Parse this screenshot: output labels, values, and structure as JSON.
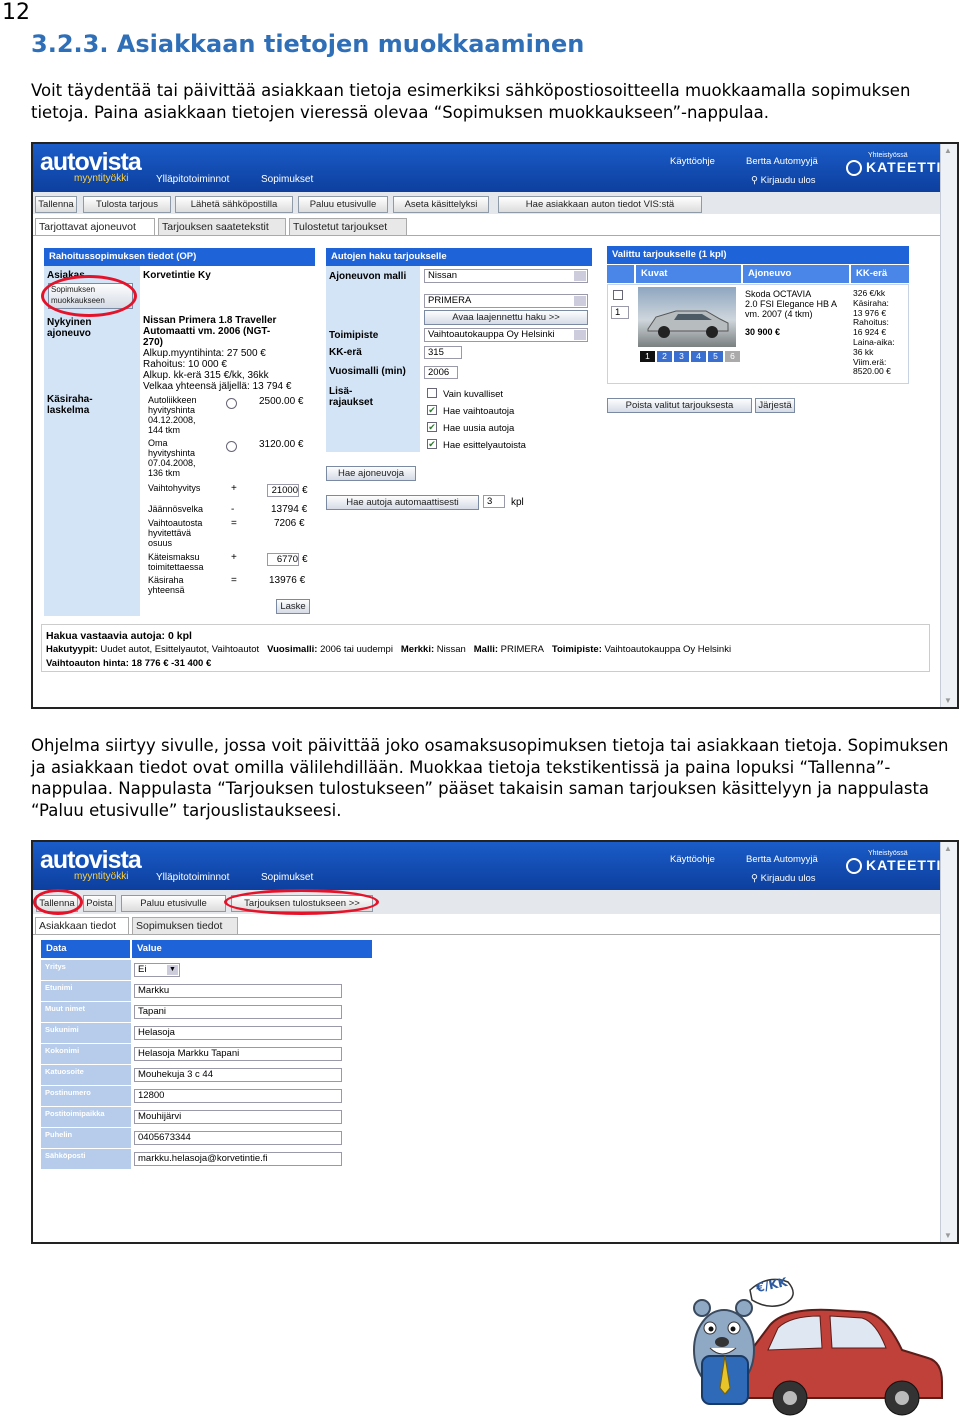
{
  "page": {
    "number": "12",
    "heading": "3.2.3. Asiakkaan tietojen muokkaaminen",
    "intro": "Voit täydentää tai päivittää asiakkaan tietoja esimerkiksi sähköpostiosoitteella muokkaamalla sopimuksen tietoja. Paina asiakkaan tietojen vieressä olevaa “Sopimuksen muokkaukseen”-nappulaa.",
    "middle": "Ohjelma siirtyy sivulle, jossa voit päivittää joko osamaksusopimuksen tietoja tai asiakkaan tietoja. Sopimuksen ja asiakkaan tiedot ovat omilla välilehdillään. Muokkaa tietoja tekstikentissä ja paina lopuksi “Tallenna”-nappulaa. Nappulasta “Tarjouksen tulostukseen” pääset takaisin saman tarjouksen käsittelyyn ja nappulasta “Paluu etusivulle” tarjouslistaukseesi."
  },
  "app": {
    "logo": "autovista",
    "logo_sub": "myyntityökki",
    "nav_admin": "Ylläpitotoiminnot",
    "nav_contracts": "Sopimukset",
    "help": "Käyttöohje",
    "user": "Bertta Automyyjä",
    "logout": "Kirjaudu ulos",
    "partner_small": "Yhteistyössä",
    "partner": "KATEETTI"
  },
  "s1": {
    "toolbar": [
      "Tallenna",
      "Tulosta tarjous",
      "Lähetä sähköpostilla",
      "Paluu etusivulle",
      "Aseta käsittelyksi",
      "Hae asiakkaan auton tiedot VIS:stä"
    ],
    "tabs": [
      "Tarjottavat ajoneuvot",
      "Tarjouksen saatetekstit",
      "Tulostetut tarjoukset"
    ],
    "col1_header": "Rahoitussopimuksen tiedot (OP)",
    "asiakas_label": "Asiakas",
    "asiakas_value": "Korvetintie Ky",
    "edit_btn": "Sopimuksen muokkaukseen",
    "current_label": "Nykyinen ajoneuvo",
    "current_lines": [
      "Nissan Primera 1.8 Traveller",
      "Automaatti vm. 2006 (NGT-",
      "270)"
    ],
    "current_details": [
      "Alkup.myyntihinta: 27 500 €",
      "Rahoitus: 10 000 €",
      "Alkup. kk-erä 315 €/kk, 36kk",
      "Velkaa yhteensä jäljellä: 13 794 €"
    ],
    "calc_label": "Käsiraha-laskelma",
    "calc": [
      {
        "l1": "Autoliikkeen",
        "l2": "hyvityshinta",
        "l3": "04.12.2008,",
        "l4": "144 tkm",
        "v": "2500.00 €"
      },
      {
        "l1": "Oma",
        "l2": "hyvityshinta",
        "l3": "07.04.2008,",
        "l4": "136 tkm",
        "v": "3120.00 €"
      }
    ],
    "vaihtohyvitys": "Vaihtohyvitys",
    "vaihtohyvitys_v": "21000",
    "jaannos": "Jäännösvelka",
    "jaannos_v": "13794 €",
    "vaihtoauto1": "Vaihtoautosta",
    "vaihtoauto2": "hyvitettävä",
    "vaihtoauto3": "osuus",
    "vaihtoauto_v": "7206 €",
    "kate1": "Käteismaksu",
    "kate2": "toimitettaessa",
    "kate_v": "6770",
    "kasi1": "Käsiraha",
    "kasi2": "yhteensä",
    "kasi_v": "13976 €",
    "plus": "+",
    "minus": "-",
    "eq": "=",
    "euro": "€",
    "laske": "Laske",
    "col2_header": "Autojen haku tarjoukselle",
    "model_label": "Ajoneuvon malli",
    "make_value": "Nissan",
    "model_value": "PRIMERA",
    "expand_btn": "Avaa laajennettu haku >>",
    "toimipiste_label": "Toimipiste",
    "toimipiste_value": "Vaihtoautokauppa Oy Helsinki",
    "kk_label": "KK-erä",
    "kk_value": "315",
    "year_label": "Vuosimalli (min)",
    "year_value": "2006",
    "extra_label": "Lisä-rajaukset",
    "extra": [
      "Vain kuvalliset",
      "Hae vaihtoautoja",
      "Hae uusia autoja",
      "Hae esittelyautoista"
    ],
    "search_btn": "Hae ajoneuvoja",
    "auto_btn": "Hae autoja automaattisesti",
    "auto_count": "3",
    "kpl": "kpl",
    "col3_header": "Valittu tarjoukselle (1 kpl)",
    "col3_cols": [
      "Kuvat",
      "Ajoneuvo",
      "KK-erä"
    ],
    "row_num": "1",
    "car_lines": [
      "Skoda OCTAVIA",
      "2.0 FSI Elegance HB A",
      "vm. 2007 (4 tkm)"
    ],
    "car_price": "30 900 €",
    "kk_lines": [
      "326 €/kk",
      "Käsiraha:",
      "13 976 €",
      "Rahoitus:",
      "16 924 €",
      "Laina-aika:",
      "36 kk",
      "Viim.erä:",
      "8520.00 €"
    ],
    "pages": [
      "1",
      "2",
      "3",
      "4",
      "5",
      "6"
    ],
    "remove_btn": "Poista valitut tarjouksesta",
    "sort_btn": "Järjestä",
    "result_title": "Hakua vastaavia autoja: 0 kpl",
    "result_line1_parts": [
      [
        "Hakutyypit:",
        "Uudet autot, Esittelyautot, Vaihtoautot"
      ],
      [
        "Vuosimalli:",
        "2006 tai uudempi"
      ],
      [
        "Merkki:",
        "Nissan"
      ],
      [
        "Malli:",
        "PRIMERA"
      ],
      [
        "Toimipiste:",
        "Vaihtoautokauppa Oy Helsinki"
      ]
    ],
    "result_line2_label": "Vaihtoauton hinta:",
    "result_line2_value": "18 776 € -31 400 €"
  },
  "s2": {
    "toolbar": [
      "Tallenna",
      "Poista",
      "Paluu etusivulle",
      "Tarjouksen tulostukseen >>"
    ],
    "tabs": [
      "Asiakkaan tiedot",
      "Sopimuksen tiedot"
    ],
    "head_data": "Data",
    "head_value": "Value",
    "rows": [
      {
        "k": "Yritys",
        "v": "Ei",
        "type": "select"
      },
      {
        "k": "Etunimi",
        "v": "Markku"
      },
      {
        "k": "Muut nimet",
        "v": "Tapani"
      },
      {
        "k": "Sukunimi",
        "v": "Helasoja"
      },
      {
        "k": "Kokonimi",
        "v": "Helasoja Markku Tapani"
      },
      {
        "k": "Katuosoite",
        "v": "Mouhekuja 3 c 44"
      },
      {
        "k": "Postinumero",
        "v": "12800"
      },
      {
        "k": "Postitoimipaikka",
        "v": "Mouhijärvi"
      },
      {
        "k": "Puhelin",
        "v": "0405673344"
      },
      {
        "k": "Sähköposti",
        "v": "markku.helasoja@korvetintie.fi"
      }
    ]
  },
  "mascot": {
    "tag": "€/KK"
  }
}
